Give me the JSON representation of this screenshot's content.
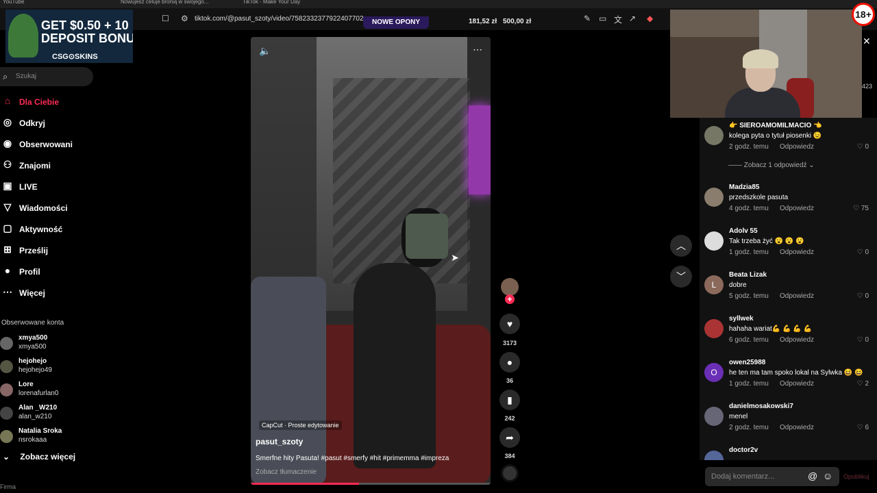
{
  "browser": {
    "tabs": [
      "YouTube",
      "Nowujesz celuje bronią w swojego...",
      "TikTok - Make Your Day"
    ],
    "url": "tiktok.com/@pasut_szoty/video/7582332377922407702"
  },
  "overlay": {
    "promo_label": "NOWE OPONY",
    "price1": "181,52 zł",
    "price2": "500,00 zł",
    "age_badge": "18+",
    "side_count": "423"
  },
  "ad": {
    "headline": "GET $0.50 + 10\nDEPOSIT BONU",
    "brand": "CSG⊙SKINS"
  },
  "sidebar": {
    "search_placeholder": "Szukaj",
    "nav": [
      {
        "label": "Dla Ciebie",
        "icon": "home-icon"
      },
      {
        "label": "Odkryj",
        "icon": "compass-icon"
      },
      {
        "label": "Obserwowani",
        "icon": "following-icon"
      },
      {
        "label": "Znajomi",
        "icon": "friends-icon"
      },
      {
        "label": "LIVE",
        "icon": "live-icon"
      },
      {
        "label": "Wiadomości",
        "icon": "messages-icon"
      },
      {
        "label": "Aktywność",
        "icon": "activity-icon"
      },
      {
        "label": "Prześlij",
        "icon": "upload-icon"
      },
      {
        "label": "Profil",
        "icon": "profile-icon"
      },
      {
        "label": "Więcej",
        "icon": "more-icon"
      }
    ],
    "followed_title": "Obserwowane konta",
    "accounts": [
      {
        "name": "xmya500",
        "user": "xmya500"
      },
      {
        "name": "hejohejo",
        "user": "hejohejo49"
      },
      {
        "name": "Lore",
        "user": "lorenafurlan0"
      },
      {
        "name": "Alan _W210",
        "user": "alan_w210"
      },
      {
        "name": "Natalia Sroka",
        "user": "nsrokaaa"
      }
    ],
    "see_more": "Zobacz więcej",
    "footer": "Firma"
  },
  "video": {
    "capcut": "CapCut · Proste edytowanie",
    "author": "pasut_szoty",
    "description": "Smerfne hity Pasuta! #pasut #smerfy #hit #primemma #impreza",
    "translate": "Zobacz tłumaczenie",
    "progress": 0.45
  },
  "actions": {
    "likes": "3173",
    "comments": "36",
    "saves": "242",
    "shares": "384"
  },
  "comments": [
    {
      "name": "👉 SIEROAMOMILMACIO 👈",
      "text": "kolega pyta o tytuł piosenki 😉",
      "time": "2 godz. temu",
      "reply": "Odpowiedz",
      "likes": "0",
      "initial": ""
    },
    {
      "name": "Madzia85",
      "text": "przedszkole pasuta",
      "time": "4 godz. temu",
      "reply": "Odpowiedz",
      "likes": "75",
      "initial": ""
    },
    {
      "name": "Adolv 55",
      "text": "Tak trzeba żyć 😮 😮 😮",
      "time": "1 godz. temu",
      "reply": "Odpowiedz",
      "likes": "0",
      "initial": ""
    },
    {
      "name": "Beata Lizak",
      "text": "dobre",
      "time": "5 godz. temu",
      "reply": "Odpowiedz",
      "likes": "0",
      "initial": "L"
    },
    {
      "name": "syllwek",
      "text": "hahaha wariat💪 💪 💪 💪",
      "time": "6 godz. temu",
      "reply": "Odpowiedz",
      "likes": "0",
      "initial": ""
    },
    {
      "name": "owen25988",
      "text": "he ten ma tam spoko lokal na Sylwka 😆 😆",
      "time": "1 godz. temu",
      "reply": "Odpowiedz",
      "likes": "2",
      "initial": "O"
    },
    {
      "name": "danielmosakowski7",
      "text": "menel",
      "time": "2 godz. temu",
      "reply": "Odpowiedz",
      "likes": "6",
      "initial": ""
    },
    {
      "name": "doctor2v",
      "text": "",
      "time": "",
      "reply": "",
      "likes": "",
      "initial": ""
    }
  ],
  "replies_link": "—— Zobacz 1 odpowiedź ⌄",
  "comment_input": {
    "placeholder": "Dodaj komentarz...",
    "publish": "Opublikuj"
  },
  "colors": {
    "accent": "#fe2c55",
    "background": "#000000",
    "panel": "#121212"
  }
}
